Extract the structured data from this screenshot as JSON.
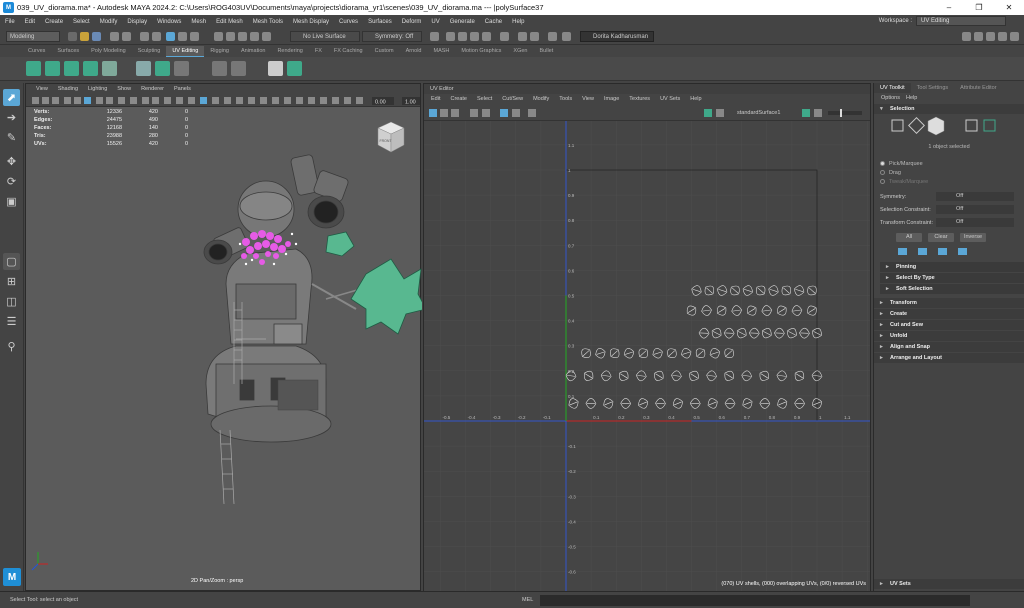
{
  "window": {
    "title": "039_UV_diorama.ma* - Autodesk MAYA 2024.2: C:\\Users\\ROG403UV\\Documents\\maya\\projects\\diorama_yr1\\scenes\\039_UV_diorama.ma  ---  |polySurface37"
  },
  "menubar": {
    "items": [
      "File",
      "Edit",
      "Create",
      "Select",
      "Modify",
      "Display",
      "Windows",
      "Mesh",
      "Edit Mesh",
      "Mesh Tools",
      "Mesh Display",
      "Curves",
      "Surfaces",
      "Deform",
      "UV",
      "Generate",
      "Cache",
      "Help"
    ],
    "workspace_label": "Workspace :",
    "workspace_value": "UV Editing"
  },
  "statusline": {
    "mode": "Modeling",
    "live_surface": "No Live Surface",
    "symmetry": "Symmetry: Off",
    "user": "Dorita Kadharusman"
  },
  "shelf": {
    "tabs": [
      "Curves",
      "Surfaces",
      "Poly Modeling",
      "Sculpting",
      "UV Editing",
      "Rigging",
      "Animation",
      "Rendering",
      "FX",
      "FX Caching",
      "Custom",
      "Arnold",
      "MASH",
      "Motion Graphics",
      "XGen",
      "Bullet"
    ],
    "active_tab": 4
  },
  "viewport": {
    "menu": [
      "View",
      "Shading",
      "Lighting",
      "Show",
      "Renderer",
      "Panels"
    ],
    "field_a": "0.00",
    "field_b": "1.00",
    "hud": [
      {
        "k": "Verts:",
        "v1": "12336",
        "v2": "420",
        "v3": "0"
      },
      {
        "k": "Edges:",
        "v1": "24475",
        "v2": "490",
        "v3": "0"
      },
      {
        "k": "Faces:",
        "v1": "12168",
        "v2": "140",
        "v3": "0"
      },
      {
        "k": "Tris:",
        "v1": "23988",
        "v2": "280",
        "v3": "0"
      },
      {
        "k": "UVs:",
        "v1": "15526",
        "v2": "420",
        "v3": "0"
      }
    ],
    "caption": "2D Pan/Zoom : persp",
    "viewcube_label": "FRONT"
  },
  "uv_editor": {
    "header": "UV Editor",
    "menu": [
      "Edit",
      "Create",
      "Select",
      "Cut/Sew",
      "Modify",
      "Tools",
      "View",
      "Image",
      "Textures",
      "UV Sets",
      "Help"
    ],
    "mesh_name": "standardSurface1",
    "status": "(070) UV shells, (000) overlapping UVs, (0/0) reversed UVs",
    "x_ticks": [
      "-0.5",
      "-0.4",
      "-0.3",
      "-0.2",
      "-0.1",
      "0.1",
      "0.2",
      "0.3",
      "0.4",
      "0.5",
      "0.6",
      "0.7",
      "0.8",
      "0.9",
      "1",
      "1.1"
    ],
    "y_ticks": [
      "1.1",
      "1",
      "0.9",
      "0.8",
      "0.7",
      "0.6",
      "0.5",
      "0.4",
      "0.3",
      "0.2",
      "0.1",
      "-0.1",
      "-0.2",
      "-0.3",
      "-0.4",
      "-0.5",
      "-0.6",
      "-0.7"
    ]
  },
  "right_panel": {
    "tabs": [
      "UV Toolkit",
      "Tool Settings",
      "Attribute Editor"
    ],
    "menu": [
      "Options",
      "Help"
    ],
    "selection_header": "Selection",
    "object_selected": "1 object selected",
    "radios": [
      "Pick/Marquee",
      "Drag",
      "Tweak/Marquee"
    ],
    "fields": [
      {
        "label": "Symmetry:",
        "value": "Off"
      },
      {
        "label": "Selection Constraint:",
        "value": "Off"
      },
      {
        "label": "Transform Constraint:",
        "value": "Off"
      }
    ],
    "buttons": [
      "All",
      "Clear",
      "Inverse"
    ],
    "subsections": [
      "Pinning",
      "Select By Type",
      "Soft Selection"
    ],
    "sections": [
      "Transform",
      "Create",
      "Cut and Sew",
      "Unfold",
      "Align and Snap",
      "Arrange and Layout"
    ],
    "uv_sets": "UV Sets"
  },
  "helpline": {
    "message": "Select Tool: select an object",
    "mel_label": "MEL"
  },
  "colors": {
    "accent": "#5ba7d6",
    "uv_axis_u": "#cc2222",
    "uv_axis_v": "#22aa22",
    "selection": "#e65be6",
    "plant": "#58b890"
  }
}
